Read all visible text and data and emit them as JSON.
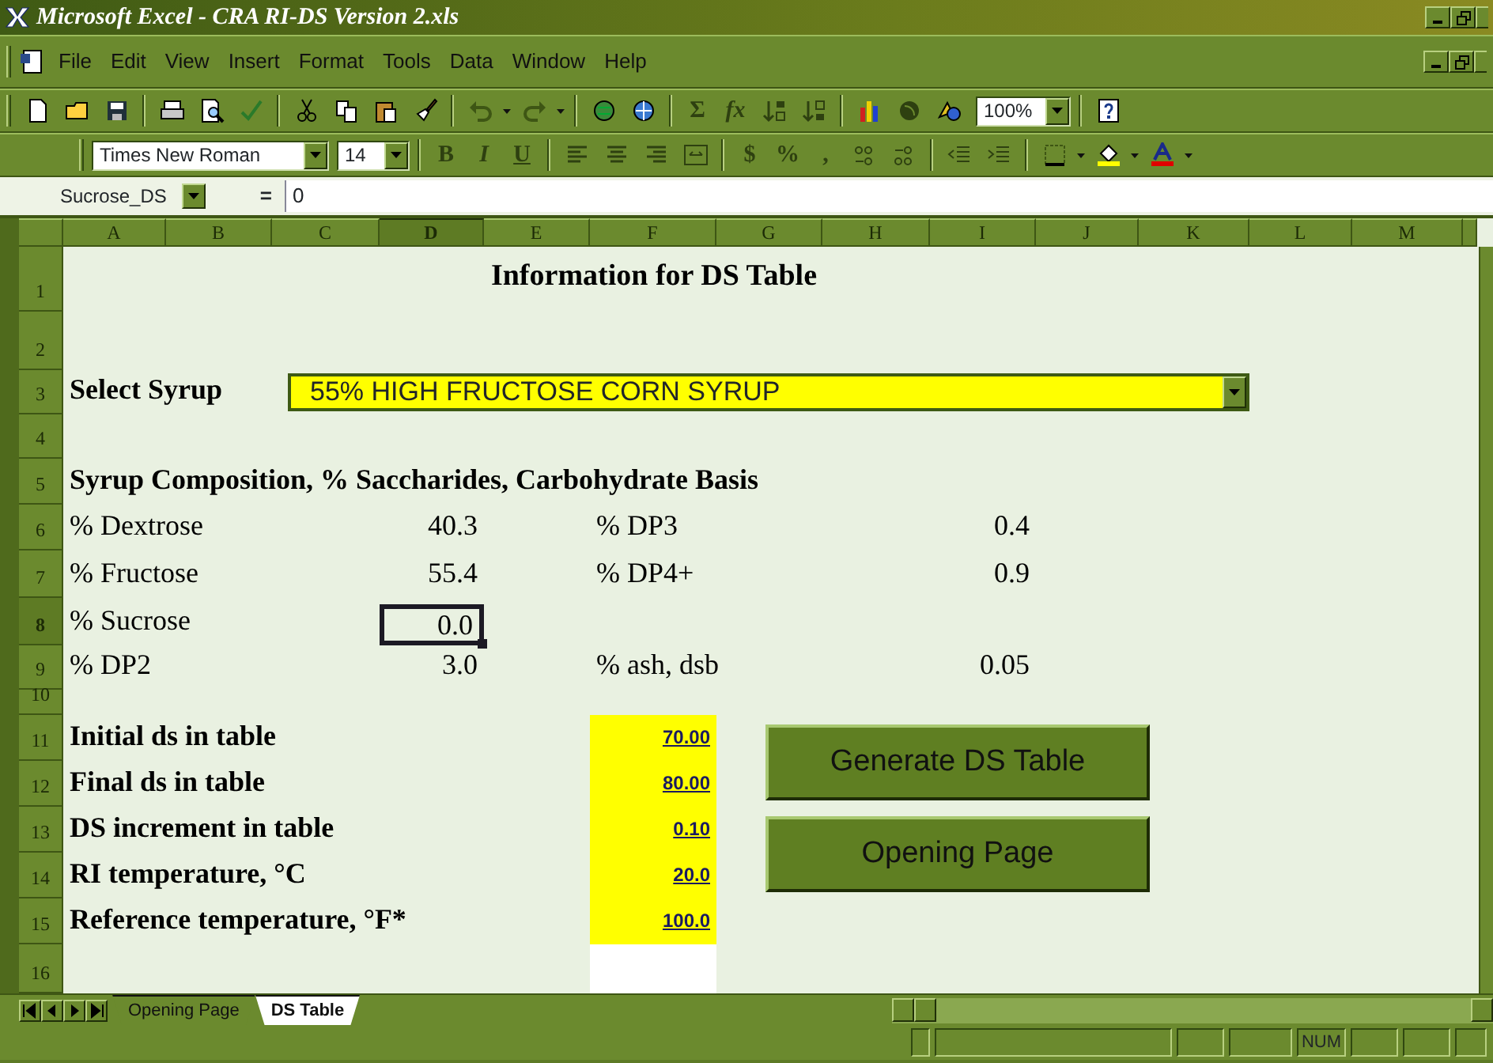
{
  "window": {
    "title": "Microsoft Excel - CRA RI-DS Version 2.xls"
  },
  "menu": [
    "File",
    "Edit",
    "View",
    "Insert",
    "Format",
    "Tools",
    "Data",
    "Window",
    "Help"
  ],
  "standard_toolbar": {
    "sum": "Σ",
    "function": "fx",
    "zoom": "100%"
  },
  "formatting_toolbar": {
    "font": "Times New Roman",
    "size": "14",
    "styles": [
      "B",
      "I",
      "U"
    ],
    "number_formats": [
      "$",
      "%",
      ","
    ]
  },
  "formula_bar": {
    "name_box": "Sucrose_DS",
    "equals": "=",
    "value": "0"
  },
  "columns": [
    {
      "label": "A",
      "selected": false
    },
    {
      "label": "B",
      "selected": false
    },
    {
      "label": "C",
      "selected": false
    },
    {
      "label": "D",
      "selected": true
    },
    {
      "label": "E",
      "selected": false
    },
    {
      "label": "F",
      "selected": false
    },
    {
      "label": "G",
      "selected": false
    },
    {
      "label": "H",
      "selected": false
    },
    {
      "label": "I",
      "selected": false
    },
    {
      "label": "J",
      "selected": false
    },
    {
      "label": "K",
      "selected": false
    },
    {
      "label": "L",
      "selected": false
    },
    {
      "label": "M",
      "selected": false
    }
  ],
  "rows": [
    {
      "number": "1",
      "selected": false,
      "cells": [
        {
          "kind": "title",
          "text": "Information for DS Table"
        }
      ]
    },
    {
      "number": "2",
      "selected": false,
      "cells": []
    },
    {
      "number": "3",
      "selected": false,
      "cells": [
        {
          "kind": "heading",
          "text": "Select Syrup"
        },
        {
          "kind": "dropdown",
          "text": "55% HIGH FRUCTOSE CORN SYRUP"
        }
      ]
    },
    {
      "number": "4",
      "selected": false,
      "cells": []
    },
    {
      "number": "5",
      "selected": false,
      "cells": [
        {
          "kind": "heading",
          "text": "Syrup Composition, % Saccharides, Carbohydrate Basis"
        }
      ]
    },
    {
      "number": "6",
      "selected": false,
      "cells": [
        {
          "kind": "item",
          "text": "% Dextrose"
        },
        {
          "kind": "amount",
          "text": "40.3"
        },
        {
          "kind": "item2",
          "text": "% DP3"
        },
        {
          "kind": "amount2",
          "text": "0.4"
        }
      ]
    },
    {
      "number": "7",
      "selected": false,
      "cells": [
        {
          "kind": "item",
          "text": "% Fructose"
        },
        {
          "kind": "amount",
          "text": "55.4"
        },
        {
          "kind": "item2",
          "text": "% DP4+"
        },
        {
          "kind": "amount2",
          "text": "0.9"
        }
      ]
    },
    {
      "number": "8",
      "selected": true,
      "cells": [
        {
          "kind": "item",
          "text": "% Sucrose"
        },
        {
          "kind": "active",
          "text": "0.0"
        }
      ]
    },
    {
      "number": "9",
      "selected": false,
      "cells": [
        {
          "kind": "item",
          "text": "% DP2"
        },
        {
          "kind": "amount",
          "text": "3.0"
        },
        {
          "kind": "item2",
          "text": "% ash, dsb"
        },
        {
          "kind": "amount2",
          "text": "0.05"
        }
      ]
    },
    {
      "number": "10",
      "selected": false,
      "cells": []
    },
    {
      "number": "11",
      "selected": false,
      "cells": [
        {
          "kind": "heading",
          "text": "Initial ds in table"
        },
        {
          "kind": "input",
          "text": "70.00"
        },
        {
          "kind": "button",
          "text": "Generate DS Table"
        }
      ]
    },
    {
      "number": "12",
      "selected": false,
      "cells": [
        {
          "kind": "heading",
          "text": "Final ds in table"
        },
        {
          "kind": "input",
          "text": "80.00"
        }
      ]
    },
    {
      "number": "13",
      "selected": false,
      "cells": [
        {
          "kind": "heading",
          "text": "DS increment in table"
        },
        {
          "kind": "input",
          "text": "0.10"
        },
        {
          "kind": "button",
          "text": "Opening Page"
        }
      ]
    },
    {
      "number": "14",
      "selected": false,
      "cells": [
        {
          "kind": "heading",
          "text": "RI temperature, °C"
        },
        {
          "kind": "input",
          "text": "20.0"
        }
      ]
    },
    {
      "number": "15",
      "selected": false,
      "cells": [
        {
          "kind": "heading",
          "text": "Reference temperature, °F*"
        },
        {
          "kind": "input",
          "text": "100.0"
        }
      ]
    },
    {
      "number": "16",
      "selected": false,
      "cells": [
        {
          "kind": "blank"
        }
      ]
    }
  ],
  "sheet_tabs": [
    {
      "label": "Opening Page",
      "selected": false
    },
    {
      "label": "DS Table",
      "selected": true
    }
  ],
  "status_bar": {
    "indicator": "NUM"
  }
}
